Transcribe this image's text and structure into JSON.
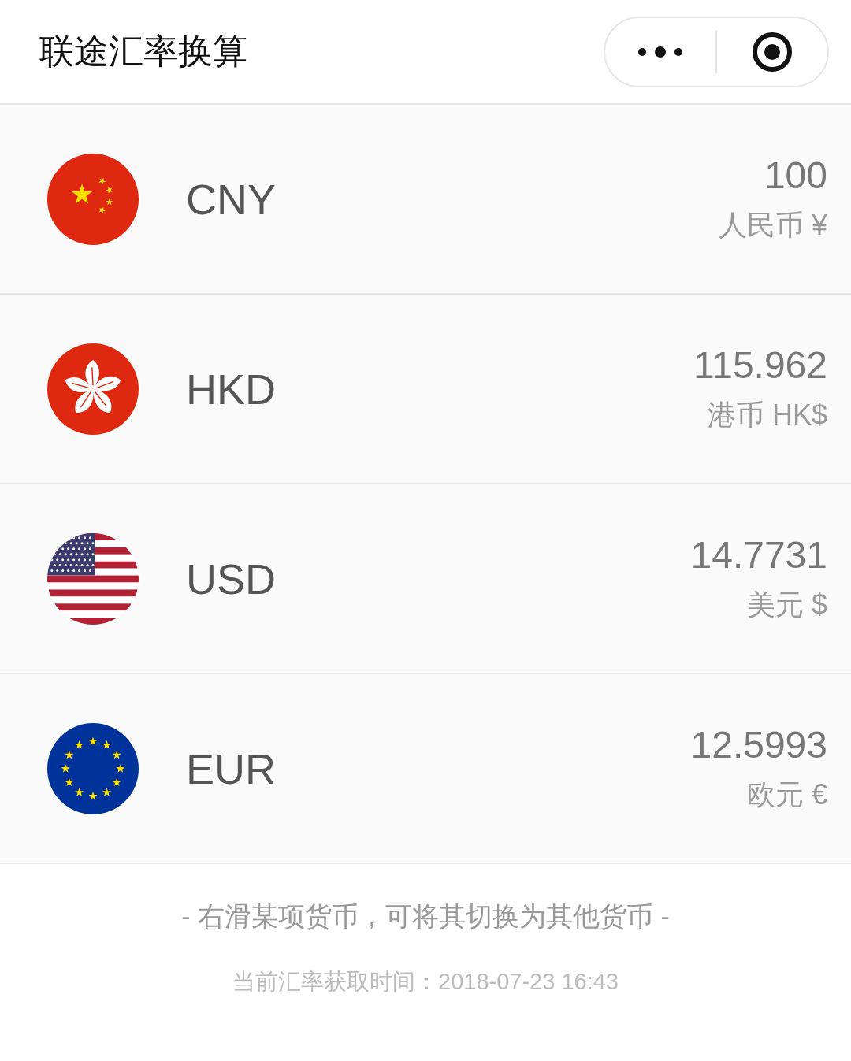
{
  "window": {
    "title": "联途汇率换算"
  },
  "currencies": [
    {
      "kind": "cn",
      "code": "CNY",
      "amount": "100",
      "name": "人民币 ¥"
    },
    {
      "kind": "hk",
      "code": "HKD",
      "amount": "115.962",
      "name": "港币 HK$"
    },
    {
      "kind": "us",
      "code": "USD",
      "amount": "14.7731",
      "name": "美元 $"
    },
    {
      "kind": "eu",
      "code": "EUR",
      "amount": "12.5993",
      "name": "欧元 €"
    }
  ],
  "hint": "- 右滑某项货币，可将其切换为其他货币 -",
  "update_time": "当前汇率获取时间：2018-07-23 16:43"
}
